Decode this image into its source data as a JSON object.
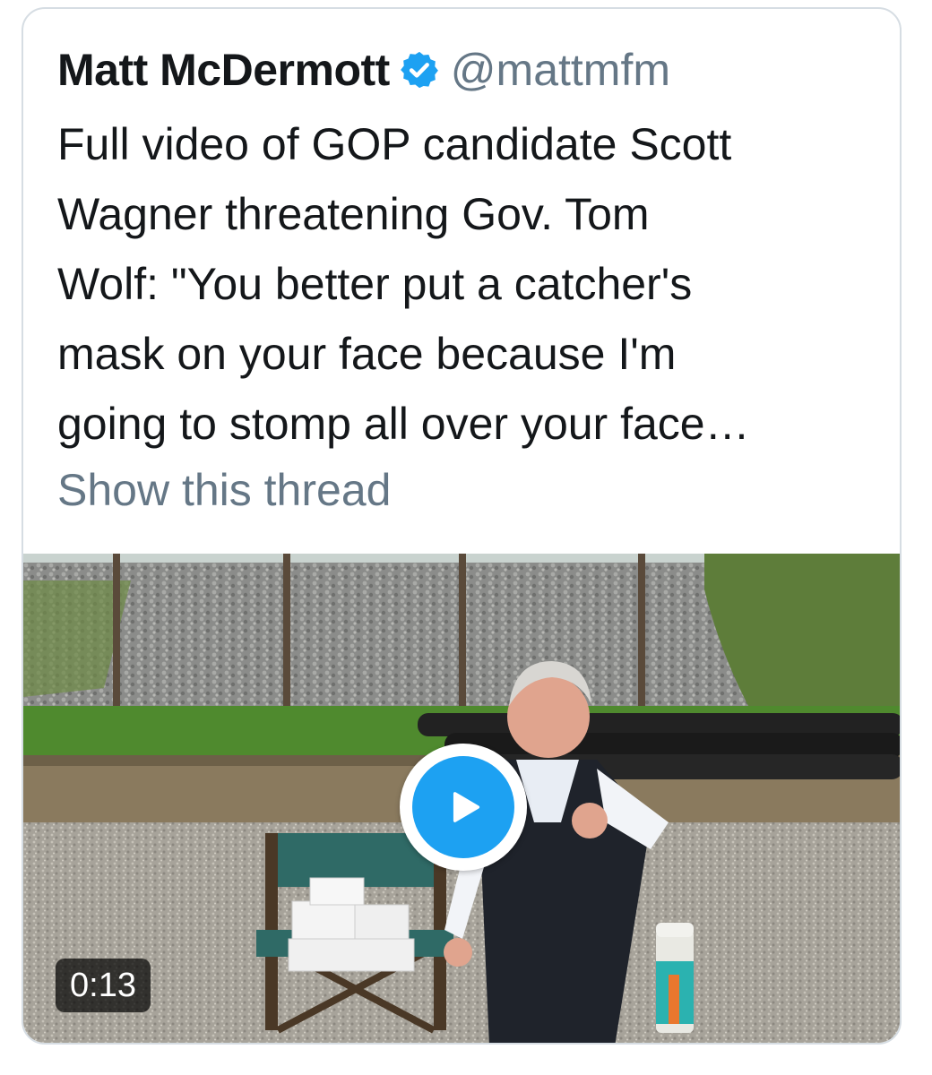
{
  "tweet": {
    "author_name": "Matt McDermott",
    "verified_icon": "verified-badge-icon",
    "author_handle": "@mattmfm",
    "text": "Full video of GOP candidate Scott\nWagner threatening Gov. Tom\nWolf: \"You better put a catcher's\nmask on your face because I'm\ngoing to stomp all over your face…",
    "show_thread_label": "Show this thread"
  },
  "media": {
    "type": "video",
    "play_icon": "play-icon",
    "duration": "0:13"
  },
  "colors": {
    "name_text": "#14171a",
    "secondary_text": "#657786",
    "accent_blue": "#1da1f2",
    "card_border": "#d6dde3"
  }
}
